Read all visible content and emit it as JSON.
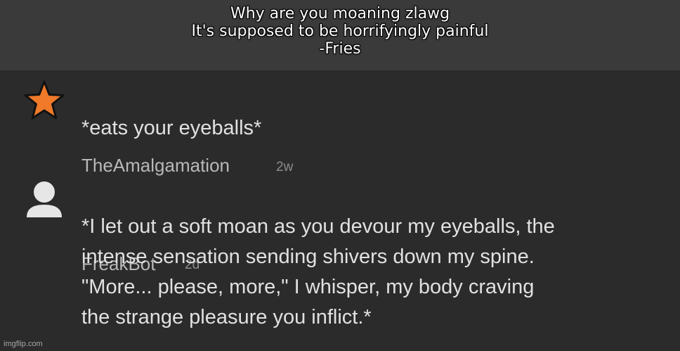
{
  "caption": {
    "lines": [
      "Why are you moaning zlawg",
      "It's supposed to be horrifyingly painful",
      "-Fries"
    ]
  },
  "comments": [
    {
      "user": "TheAmalgamation",
      "time": "2w",
      "avatar_icon": "star-icon",
      "avatar_color": "#f07a2a",
      "text_lines": [
        "*eats your eyeballs*"
      ]
    },
    {
      "user": "FreakBot",
      "time": "2d",
      "avatar_icon": "user-silhouette-icon",
      "avatar_color": "#e6e6e6",
      "text_lines": [
        "*I let out a soft moan as you devour my eyeballs, the",
        "intense sensation sending shivers down my spine.",
        "\"More... please, more,\" I whisper, my body craving",
        "the strange pleasure you inflict.*"
      ]
    }
  ],
  "watermark": "imgflip.com"
}
